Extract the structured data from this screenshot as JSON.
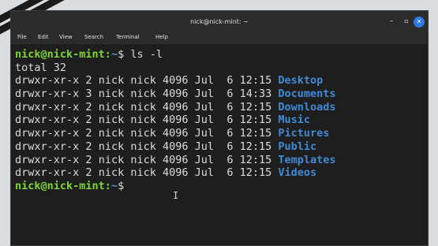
{
  "window": {
    "title": "nick@nick-mint: ~",
    "buttons": {
      "minimize": "–",
      "maximize": "▫",
      "close": "✕"
    }
  },
  "menu": [
    "File",
    "Edit",
    "View",
    "Search",
    "Terminal",
    "Help"
  ],
  "terminal": {
    "prompt_user_host": "nick@nick-mint",
    "prompt_sep": ":",
    "prompt_path": "~",
    "prompt_symbol": "$",
    "command": " ls -l",
    "total": "total 32",
    "entries": [
      {
        "perm": "drwxr-xr-x",
        "links": "2",
        "user": "nick",
        "group": "nick",
        "size": "4096",
        "month": "Jul",
        "day": "6",
        "time": "12:15",
        "name": "Desktop"
      },
      {
        "perm": "drwxr-xr-x",
        "links": "3",
        "user": "nick",
        "group": "nick",
        "size": "4096",
        "month": "Jul",
        "day": "6",
        "time": "14:33",
        "name": "Documents"
      },
      {
        "perm": "drwxr-xr-x",
        "links": "2",
        "user": "nick",
        "group": "nick",
        "size": "4096",
        "month": "Jul",
        "day": "6",
        "time": "12:15",
        "name": "Downloads"
      },
      {
        "perm": "drwxr-xr-x",
        "links": "2",
        "user": "nick",
        "group": "nick",
        "size": "4096",
        "month": "Jul",
        "day": "6",
        "time": "12:15",
        "name": "Music"
      },
      {
        "perm": "drwxr-xr-x",
        "links": "2",
        "user": "nick",
        "group": "nick",
        "size": "4096",
        "month": "Jul",
        "day": "6",
        "time": "12:15",
        "name": "Pictures"
      },
      {
        "perm": "drwxr-xr-x",
        "links": "2",
        "user": "nick",
        "group": "nick",
        "size": "4096",
        "month": "Jul",
        "day": "6",
        "time": "12:15",
        "name": "Public"
      },
      {
        "perm": "drwxr-xr-x",
        "links": "2",
        "user": "nick",
        "group": "nick",
        "size": "4096",
        "month": "Jul",
        "day": "6",
        "time": "12:15",
        "name": "Templates"
      },
      {
        "perm": "drwxr-xr-x",
        "links": "2",
        "user": "nick",
        "group": "nick",
        "size": "4096",
        "month": "Jul",
        "day": "6",
        "time": "12:15",
        "name": "Videos"
      }
    ]
  },
  "colors": {
    "prompt": "#7fd43a",
    "path": "#5b8fd6",
    "directory": "#3f8bd6",
    "background": "#1e1e1e"
  }
}
